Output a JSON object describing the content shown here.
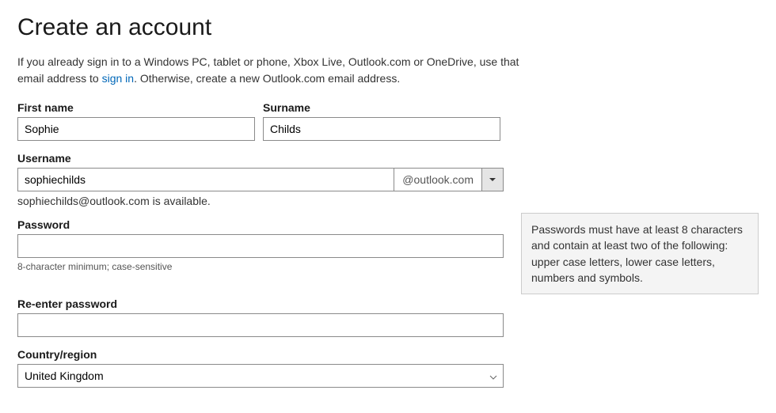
{
  "title": "Create an account",
  "intro": {
    "before": "If you already sign in to a Windows PC, tablet or phone, Xbox Live, Outlook.com or OneDrive, use that email address to ",
    "link": "sign in",
    "after": ". Otherwise, create a new Outlook.com email address."
  },
  "labels": {
    "first_name": "First name",
    "surname": "Surname",
    "username": "Username",
    "password": "Password",
    "reenter_password": "Re-enter password",
    "country_region": "Country/region"
  },
  "values": {
    "first_name": "Sophie",
    "surname": "Childs",
    "username": "sophiechilds",
    "domain": "@outlook.com",
    "password": "",
    "reenter_password": "",
    "country_region": "United Kingdom"
  },
  "availability_msg": "sophiechilds@outlook.com is available.",
  "password_hint": "8-character minimum; case-sensitive",
  "tooltip": "Passwords must have at least 8 characters and contain at least two of the following: upper case letters, lower case letters, numbers and symbols."
}
